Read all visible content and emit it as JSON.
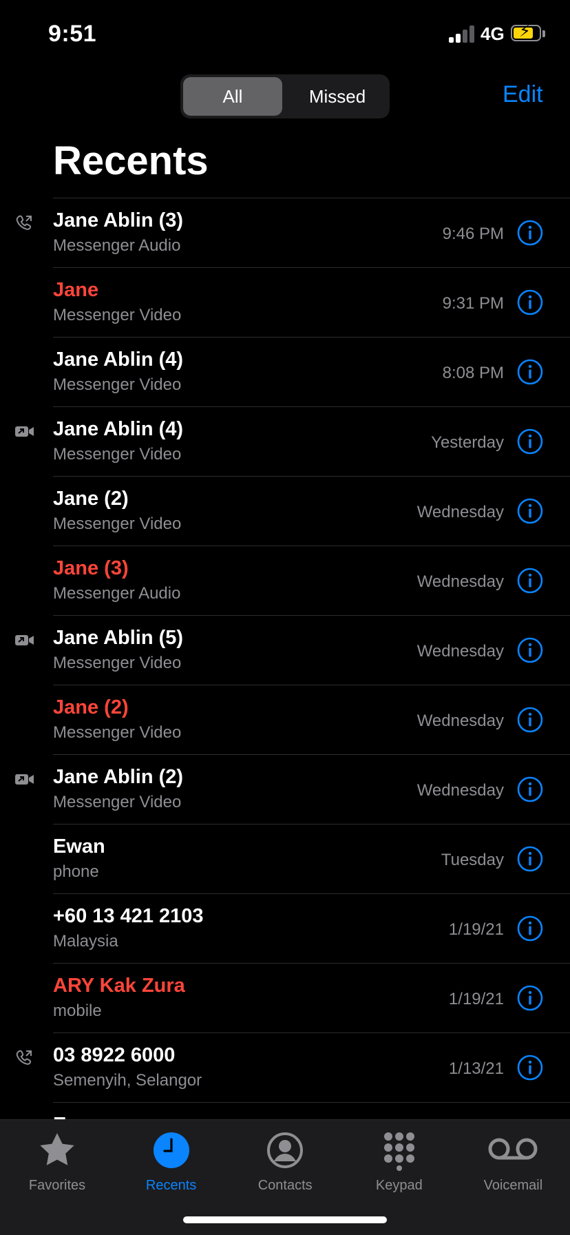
{
  "status": {
    "time": "9:51",
    "network": "4G"
  },
  "segmented": {
    "all": "All",
    "missed": "Missed"
  },
  "header": {
    "edit": "Edit",
    "title": "Recents"
  },
  "calls": [
    {
      "name": "Jane Ablin (3)",
      "detail": "Messenger Audio",
      "when": "9:46 PM",
      "missed": false,
      "icon": "outgoing-call-icon"
    },
    {
      "name": "Jane",
      "detail": "Messenger Video",
      "when": "9:31 PM",
      "missed": true,
      "icon": ""
    },
    {
      "name": "Jane Ablin (4)",
      "detail": "Messenger Video",
      "when": "8:08 PM",
      "missed": false,
      "icon": ""
    },
    {
      "name": "Jane Ablin (4)",
      "detail": "Messenger Video",
      "when": "Yesterday",
      "missed": false,
      "icon": "outgoing-video-icon"
    },
    {
      "name": "Jane (2)",
      "detail": "Messenger Video",
      "when": "Wednesday",
      "missed": false,
      "icon": ""
    },
    {
      "name": "Jane (3)",
      "detail": "Messenger Audio",
      "when": "Wednesday",
      "missed": true,
      "icon": ""
    },
    {
      "name": "Jane Ablin (5)",
      "detail": "Messenger Video",
      "when": "Wednesday",
      "missed": false,
      "icon": "outgoing-video-icon"
    },
    {
      "name": "Jane (2)",
      "detail": "Messenger Video",
      "when": "Wednesday",
      "missed": true,
      "icon": ""
    },
    {
      "name": "Jane Ablin (2)",
      "detail": "Messenger Video",
      "when": "Wednesday",
      "missed": false,
      "icon": "outgoing-video-icon"
    },
    {
      "name": "Ewan",
      "detail": "phone",
      "when": "Tuesday",
      "missed": false,
      "icon": ""
    },
    {
      "name": "+60 13 421 2103",
      "detail": "Malaysia",
      "when": "1/19/21",
      "missed": false,
      "icon": ""
    },
    {
      "name": "ARY Kak Zura",
      "detail": "mobile",
      "when": "1/19/21",
      "missed": true,
      "icon": ""
    },
    {
      "name": "03 8922 6000",
      "detail": "Semenyih, Selangor",
      "when": "1/13/21",
      "missed": false,
      "icon": "outgoing-call-icon"
    },
    {
      "name": "Ewan",
      "detail": "",
      "when": "",
      "missed": false,
      "icon": ""
    }
  ],
  "tabs": [
    {
      "label": "Favorites",
      "icon": "star-icon",
      "active": false
    },
    {
      "label": "Recents",
      "icon": "clock-icon",
      "active": true
    },
    {
      "label": "Contacts",
      "icon": "person-circle-icon",
      "active": false
    },
    {
      "label": "Keypad",
      "icon": "keypad-icon",
      "active": false
    },
    {
      "label": "Voicemail",
      "icon": "voicemail-icon",
      "active": false
    }
  ],
  "colors": {
    "accent": "#0a84ff",
    "missed": "#ff453a",
    "secondary": "#8e8e93",
    "battery": "#ffd60a"
  }
}
